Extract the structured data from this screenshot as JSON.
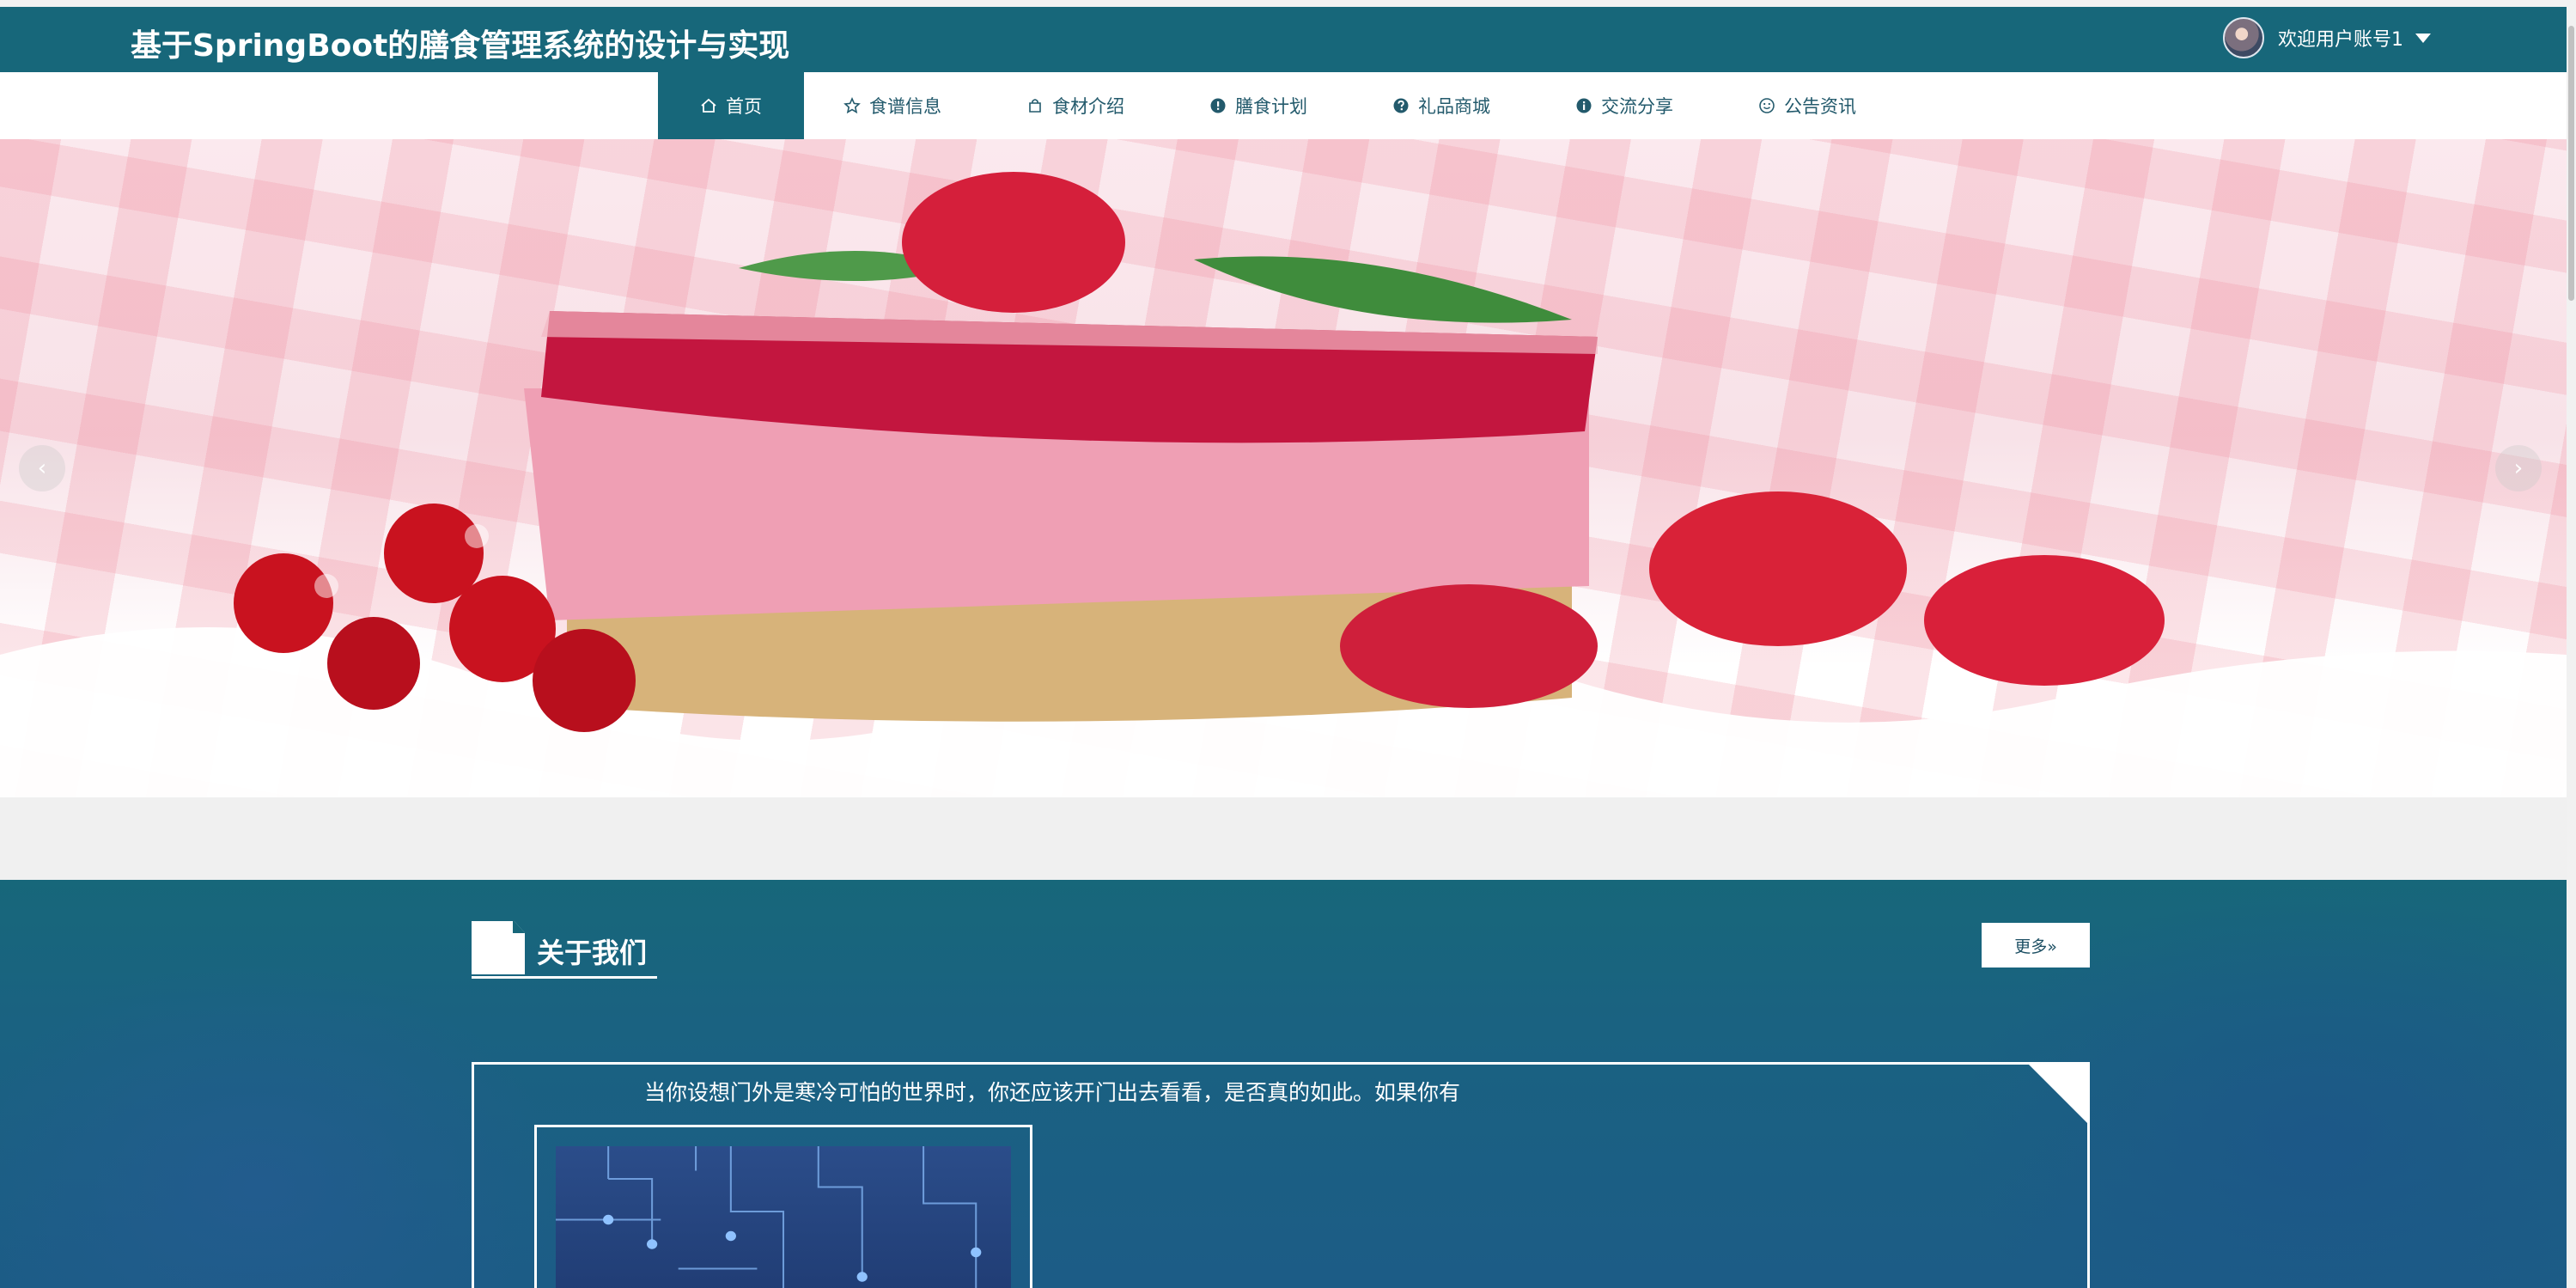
{
  "header": {
    "site_title": "基于SpringBoot的膳食管理系统的设计与实现",
    "user_greeting": "欢迎用户账号1"
  },
  "nav": {
    "items": [
      {
        "label": "首页",
        "icon": "home-icon",
        "active": true
      },
      {
        "label": "食谱信息",
        "icon": "star-icon",
        "active": false
      },
      {
        "label": "食材介绍",
        "icon": "bag-icon",
        "active": false
      },
      {
        "label": "膳食计划",
        "icon": "info-circle-icon",
        "active": false
      },
      {
        "label": "礼品商城",
        "icon": "question-circle-icon",
        "active": false
      },
      {
        "label": "交流分享",
        "icon": "info-circle-icon",
        "active": false
      },
      {
        "label": "公告资讯",
        "icon": "smile-icon",
        "active": false
      }
    ]
  },
  "banner": {
    "prev_glyph": "‹",
    "next_glyph": "›"
  },
  "about": {
    "title": "关于我们",
    "more_label": "更多»",
    "text": "当你设想门外是寒冷可怕的世界时，你还应该开门出去看看，是否真的如此。如果你有"
  },
  "colors": {
    "primary": "#17677a",
    "nav_text": "#235a6c",
    "white": "#ffffff"
  }
}
